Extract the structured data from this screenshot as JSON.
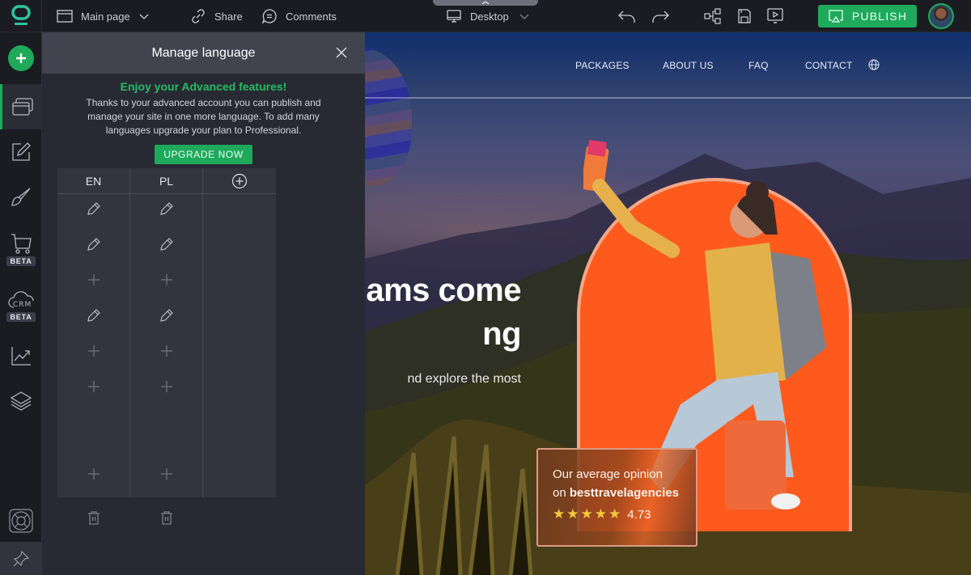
{
  "topbar": {
    "page_selector": "Main page",
    "share": "Share",
    "comments": "Comments",
    "device": "Desktop",
    "publish": "PUBLISH"
  },
  "rail": {
    "items": [
      {
        "name": "pages",
        "icon": "pages-icon",
        "active": true
      },
      {
        "name": "edit",
        "icon": "edit-icon"
      },
      {
        "name": "design",
        "icon": "brush-icon"
      },
      {
        "name": "store",
        "icon": "cart-icon",
        "badge": "BETA"
      },
      {
        "name": "crm",
        "icon": "crm-cloud-icon",
        "icon_text": "CRM",
        "badge": "BETA"
      },
      {
        "name": "statistics",
        "icon": "chart-icon"
      },
      {
        "name": "layers",
        "icon": "layers-icon"
      },
      {
        "name": "help",
        "icon": "lifebuoy-icon"
      },
      {
        "name": "pin",
        "icon": "pin-icon"
      }
    ]
  },
  "panel": {
    "title": "Manage language",
    "promo_title": "Enjoy your Advanced features!",
    "promo_text": "Thanks to your advanced account you can publish and manage your site in one more language. To add many languages upgrade your plan to Professional.",
    "upgrade": "UPGRADE NOW",
    "languages": [
      {
        "code": "EN",
        "rows": [
          "edit",
          "edit",
          "add",
          "edit",
          "add",
          "add",
          "add"
        ]
      },
      {
        "code": "PL",
        "rows": [
          "edit",
          "edit",
          "add",
          "edit",
          "add",
          "add",
          "add"
        ]
      }
    ]
  },
  "site": {
    "nav": [
      "PACKAGES",
      "ABOUT US",
      "FAQ",
      "CONTACT"
    ],
    "hero_title_1": "ams come",
    "hero_title_2": "ng",
    "hero_sub": "nd explore the most",
    "review": {
      "line1": "Our average opinion",
      "line2_prefix": "on ",
      "line2_brand": "besttravelagencies",
      "stars": 5,
      "rating": "4.73"
    }
  },
  "colors": {
    "accent": "#1fa95b",
    "promo_title": "#27ba63",
    "arch": "#fe5a1d",
    "star": "#f6c83d"
  }
}
